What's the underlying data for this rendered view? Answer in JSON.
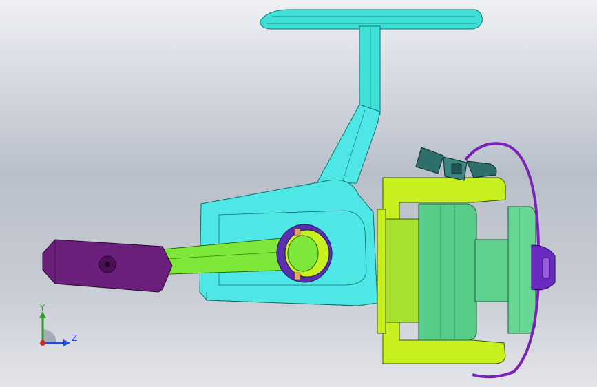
{
  "colors": {
    "background_top": "#eef0f4",
    "background_mid": "#b9bfca",
    "handle_bar": "#3fe0d8",
    "reel_body": "#4fe6e6",
    "crank_arm": "#7de83a",
    "knob": "#6a1f7a",
    "frame": "#c8f01e",
    "spool": "#55cc88",
    "bail_wire": "#7a22b8",
    "line_roller": "#2f6f6a",
    "axis_y": "#2ca02c",
    "axis_z": "#1f4fd8",
    "axis_x": "#d62728"
  },
  "model": {
    "parts": [
      "reel-seat-foot-icon",
      "reel-stem-icon",
      "reel-body-icon",
      "crank-arm-icon",
      "crank-knob-icon",
      "rotor-frame-icon",
      "spool-icon",
      "bail-wire-icon",
      "line-roller-icon"
    ]
  },
  "triad": {
    "y_label": "Y",
    "z_label": "Z"
  }
}
